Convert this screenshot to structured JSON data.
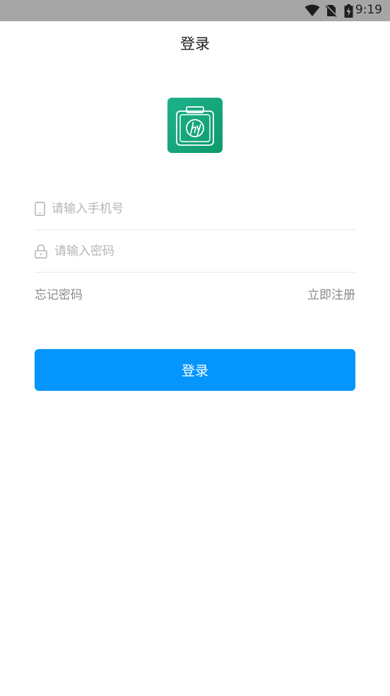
{
  "status_bar": {
    "time": "9:19",
    "icons": [
      "wifi-icon",
      "no-sim-icon",
      "battery-charging-icon"
    ]
  },
  "header": {
    "title": "登录"
  },
  "logo": {
    "icon": "briefcase-logo",
    "letters": "hy",
    "colors": [
      "#1fb28b",
      "#0d9a6c"
    ]
  },
  "form": {
    "phone": {
      "placeholder": "请输入手机号",
      "value": "",
      "icon": "phone-icon"
    },
    "password": {
      "placeholder": "请输入密码",
      "value": "",
      "icon": "lock-icon"
    },
    "forgot_label": "忘记密码",
    "register_label": "立即注册",
    "login_label": "登录"
  },
  "colors": {
    "status_bar": "#a6a6a6",
    "primary": "#0495fd",
    "divider": "#e8e8e8",
    "placeholder": "#b5b5b5",
    "link": "#8a8a8a"
  }
}
